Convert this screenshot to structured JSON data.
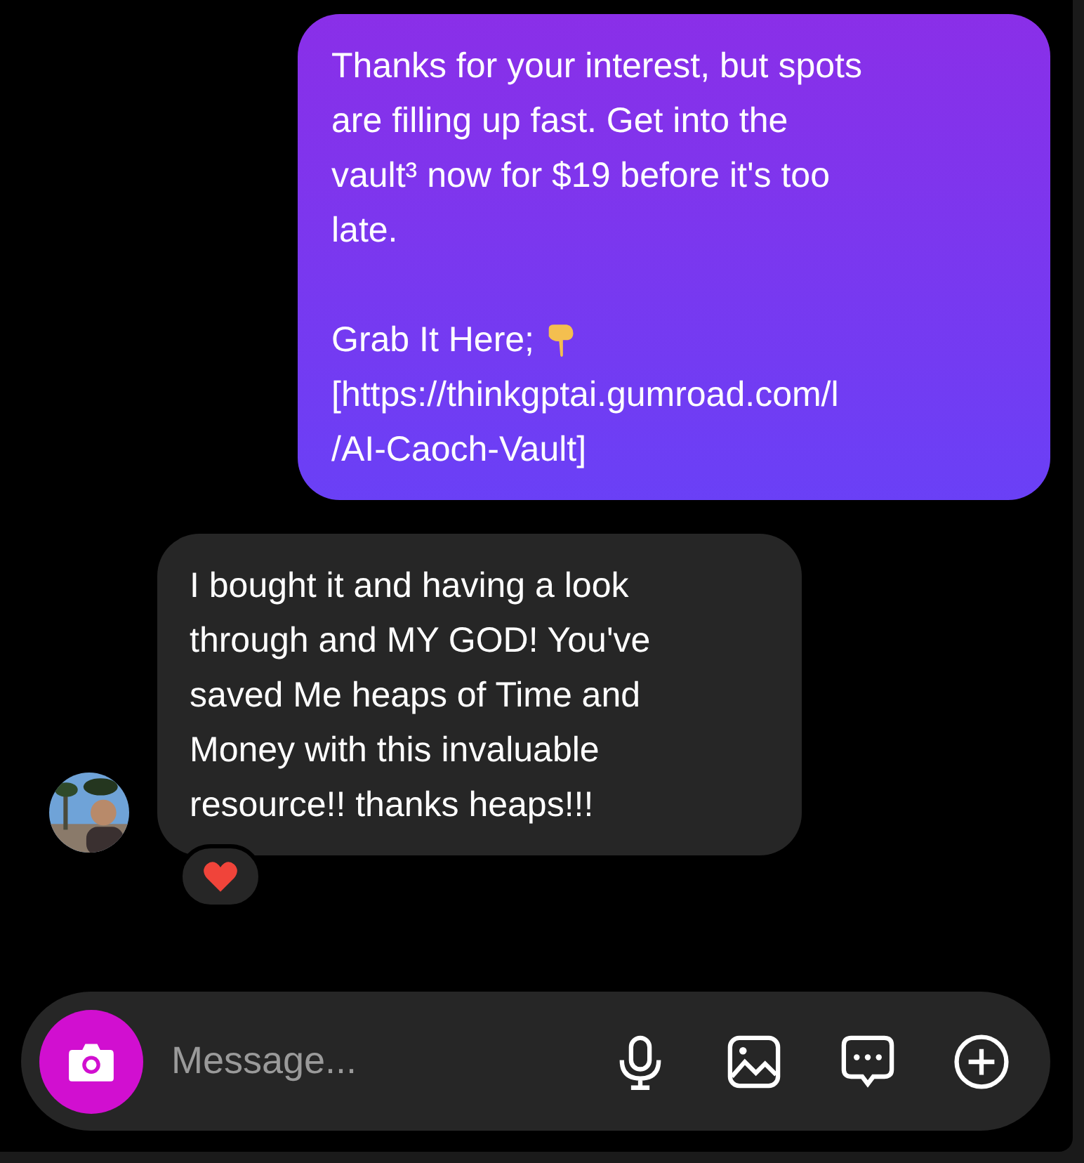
{
  "messages": [
    {
      "kind": "sent",
      "lines": [
        {
          "text": "Thanks for your interest, but spots"
        },
        {
          "text": "are filling up fast. Get into the"
        },
        {
          "text": "vault³ now for $19 before it's too"
        },
        {
          "text": "late."
        },
        {
          "text": "Grab It Here;",
          "emoji": {
            "kind": "point-down"
          },
          "gap": true
        },
        {
          "text": "[https://thinkgptai.gumroad.com/l"
        },
        {
          "text": "/AI-Caoch-Vault]"
        }
      ]
    },
    {
      "kind": "received",
      "avatar": true,
      "reaction": {
        "kind": "heart"
      },
      "lines": [
        {
          "text": "I bought it and having a look"
        },
        {
          "text": "through and MY GOD! You've"
        },
        {
          "text": "saved Me heaps of Time and"
        },
        {
          "text": "Money with this invaluable"
        },
        {
          "text": "resource!! thanks heaps!!!"
        }
      ]
    }
  ],
  "composer": {
    "placeholder": "Message..."
  }
}
